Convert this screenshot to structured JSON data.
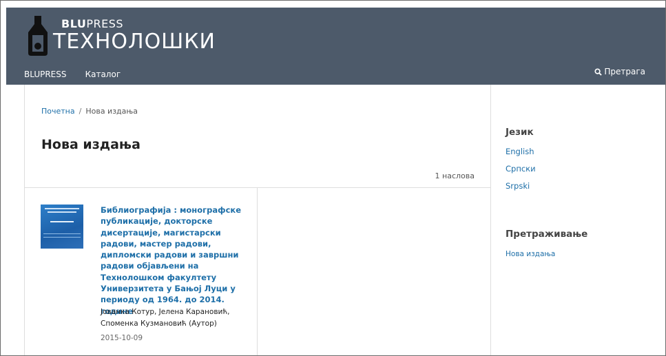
{
  "header": {
    "brand_small_bold": "BLU",
    "brand_small_rest": "PRESS",
    "brand_big": "ТЕХНОЛОШКИ",
    "bg_color": "#4d5a6a"
  },
  "nav": {
    "items": [
      {
        "label": "BLUPRESS"
      },
      {
        "label": "Каталог"
      }
    ],
    "search_label": "Претрага"
  },
  "breadcrumb": {
    "home": "Почетна",
    "separator": "/",
    "current": "Нова издања"
  },
  "main": {
    "title": "Нова издања",
    "count": "1 наслова",
    "books": [
      {
        "title": "Библиографија : монографске публикације, докторске дисертације, магистарски радови, мастер радови, дипломски радови и завршни радови објављени на Технолошком факултету Универзитета у Бањој Луци у периоду од 1964. до 2014. године",
        "authors": "Јованка Котур, Јелена Карановић, Споменка Кузмановић (Аутор)",
        "date": "2015-10-09"
      }
    ]
  },
  "sidebar": {
    "language_heading": "Језик",
    "languages": [
      {
        "label": "English"
      },
      {
        "label": "Српски"
      },
      {
        "label": "Srpski"
      }
    ],
    "browse_heading": "Претраживање",
    "browse_links": [
      {
        "label": "Нова издања"
      }
    ]
  },
  "colors": {
    "link": "#1e6fa8",
    "header_bg": "#4d5a6a"
  }
}
